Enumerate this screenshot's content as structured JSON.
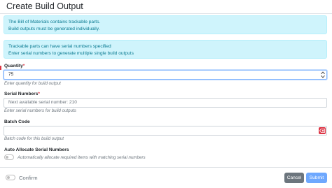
{
  "modal": {
    "title": "Create Build Output"
  },
  "alerts": [
    {
      "lines": [
        "The Bill of Materials contains trackable parts.",
        "Build outputs must be generated individually."
      ]
    },
    {
      "lines": [
        "Trackable parts can have serial numbers specified",
        "Enter serial numbers to generate multiple single build outputs"
      ]
    }
  ],
  "fields": {
    "quantity": {
      "label": "Quantity",
      "required_mark": "*",
      "value": "75",
      "help": "Enter quantity for build output"
    },
    "serial_numbers": {
      "label": "Serial Numbers",
      "required_mark": "*",
      "placeholder": "Next available serial number: 210",
      "help": "Enter serial numbers for build outputs"
    },
    "batch_code": {
      "label": "Batch Code",
      "value": "",
      "help": "Batch code for this build output"
    },
    "auto_allocate": {
      "label": "Auto Allocate Serial Numbers",
      "toggle_label": "Automatically allocate required items with matching serial numbers",
      "checked": false
    }
  },
  "footer": {
    "confirm_label": "Confirm",
    "cancel_label": "Cancel",
    "submit_label": "Submit"
  },
  "colors": {
    "info_bg": "#cff4fc",
    "info_text": "#087990",
    "danger": "#dc3545",
    "secondary": "#6c757d",
    "primary_disabled": "#6ea8fe"
  },
  "icons": {
    "stepper": "up-down-arrows-icon",
    "clear": "backspace-icon"
  }
}
